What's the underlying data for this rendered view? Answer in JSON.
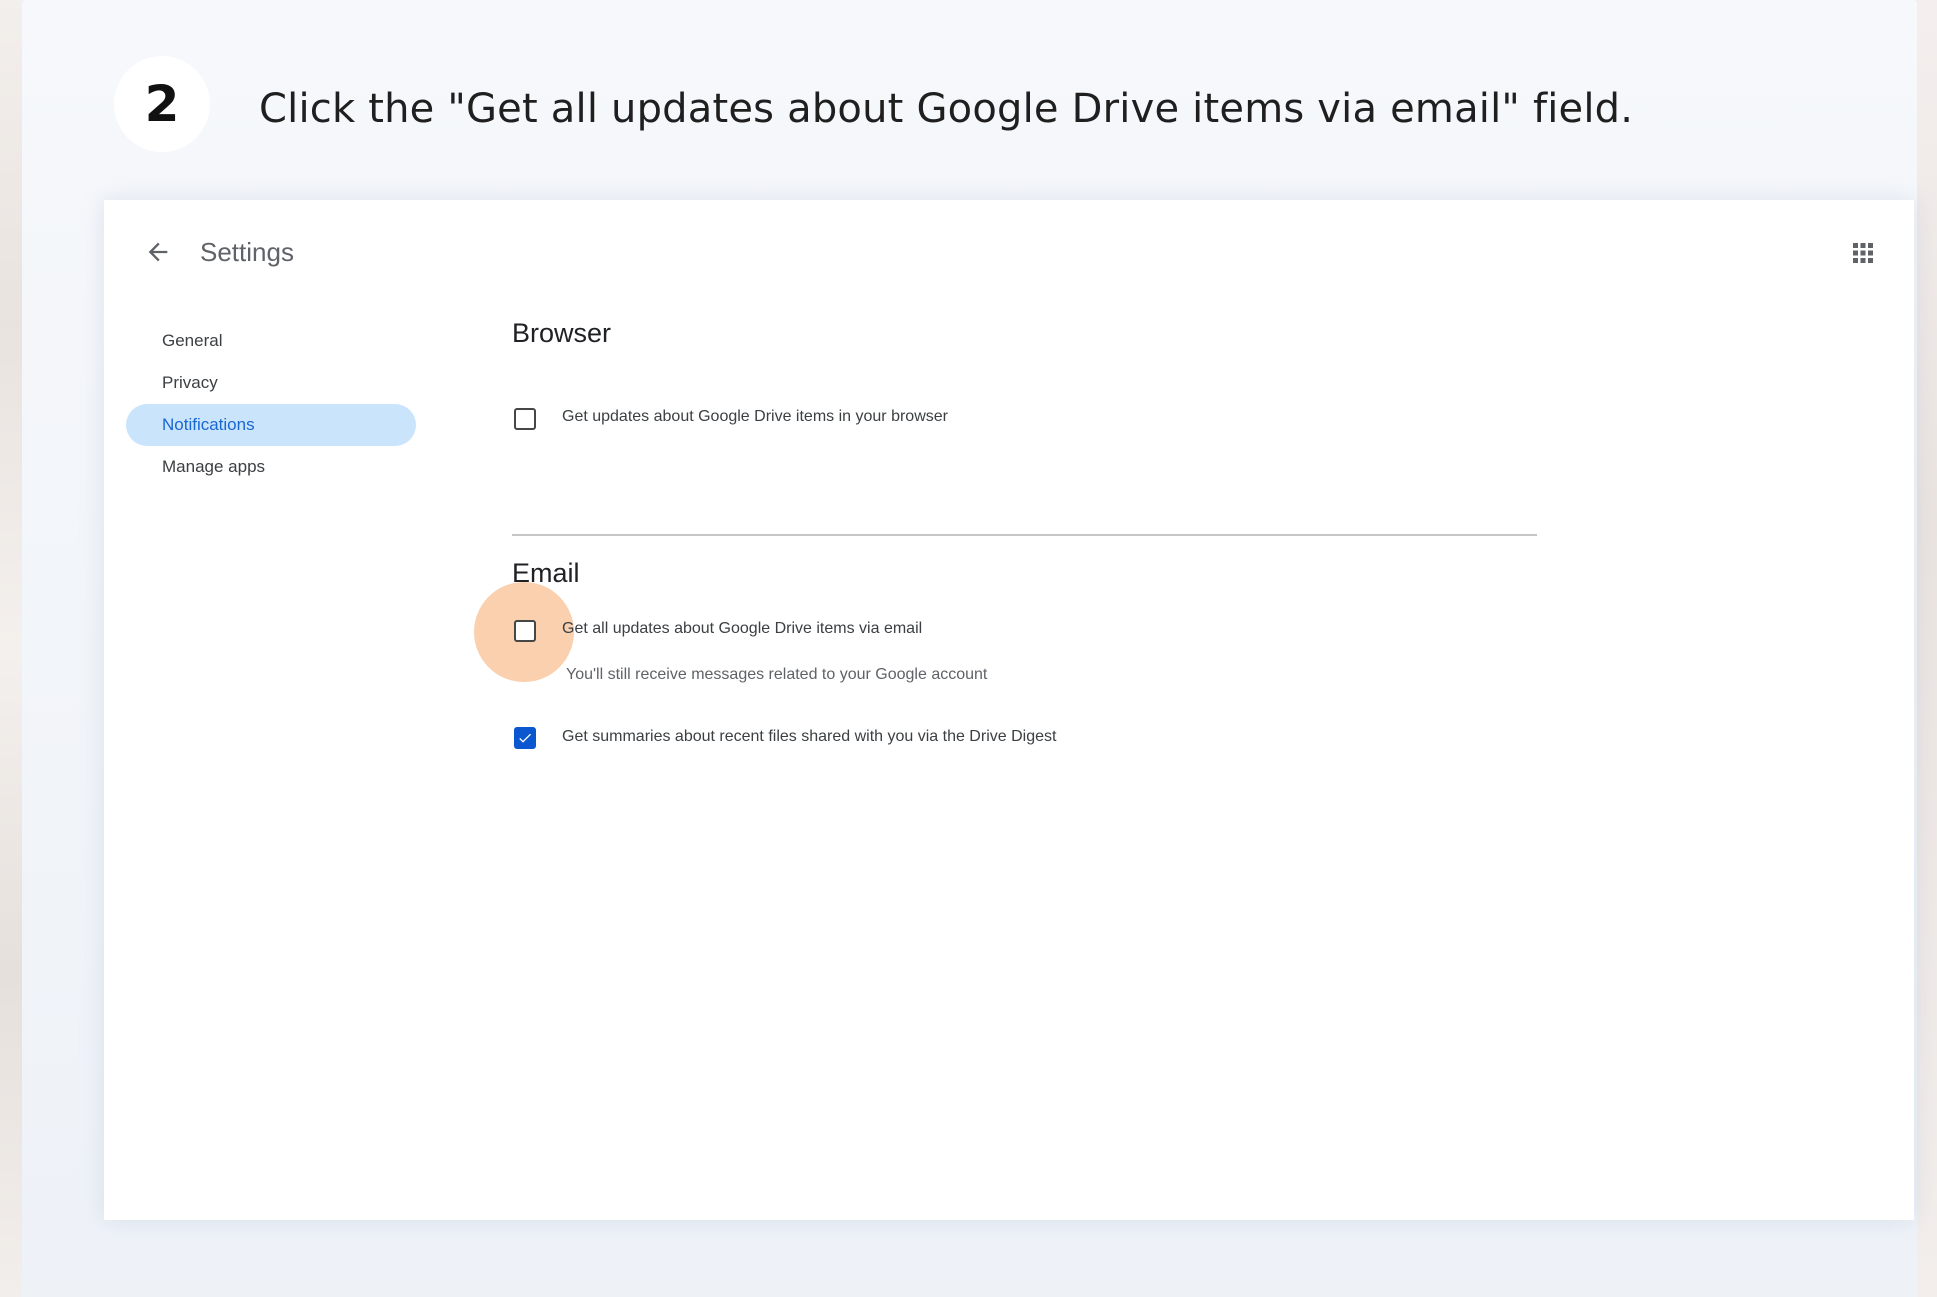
{
  "step": {
    "number": "2",
    "instruction": "Click the \"Get all updates about Google Drive items via email\" field."
  },
  "header": {
    "title": "Settings",
    "back_icon": "arrow-back-icon",
    "apps_icon": "apps-grid-icon"
  },
  "sidebar": {
    "items": [
      {
        "label": "General",
        "active": false
      },
      {
        "label": "Privacy",
        "active": false
      },
      {
        "label": "Notifications",
        "active": true
      },
      {
        "label": "Manage apps",
        "active": false
      }
    ]
  },
  "browser_section": {
    "title": "Browser",
    "option": {
      "label": "Get updates about Google Drive items in your browser",
      "checked": false
    }
  },
  "email_section": {
    "title": "Email",
    "options": [
      {
        "label": "Get all updates about Google Drive items via email",
        "sublabel": "You'll still receive messages related to your Google account",
        "checked": false,
        "highlighted": true
      },
      {
        "label": "Get summaries about recent files shared with you via the Drive Digest",
        "checked": true
      }
    ]
  },
  "colors": {
    "accent": "#0b57d0",
    "active_nav_bg": "#c9e4fb",
    "click_highlight": "#f5aa6e"
  }
}
